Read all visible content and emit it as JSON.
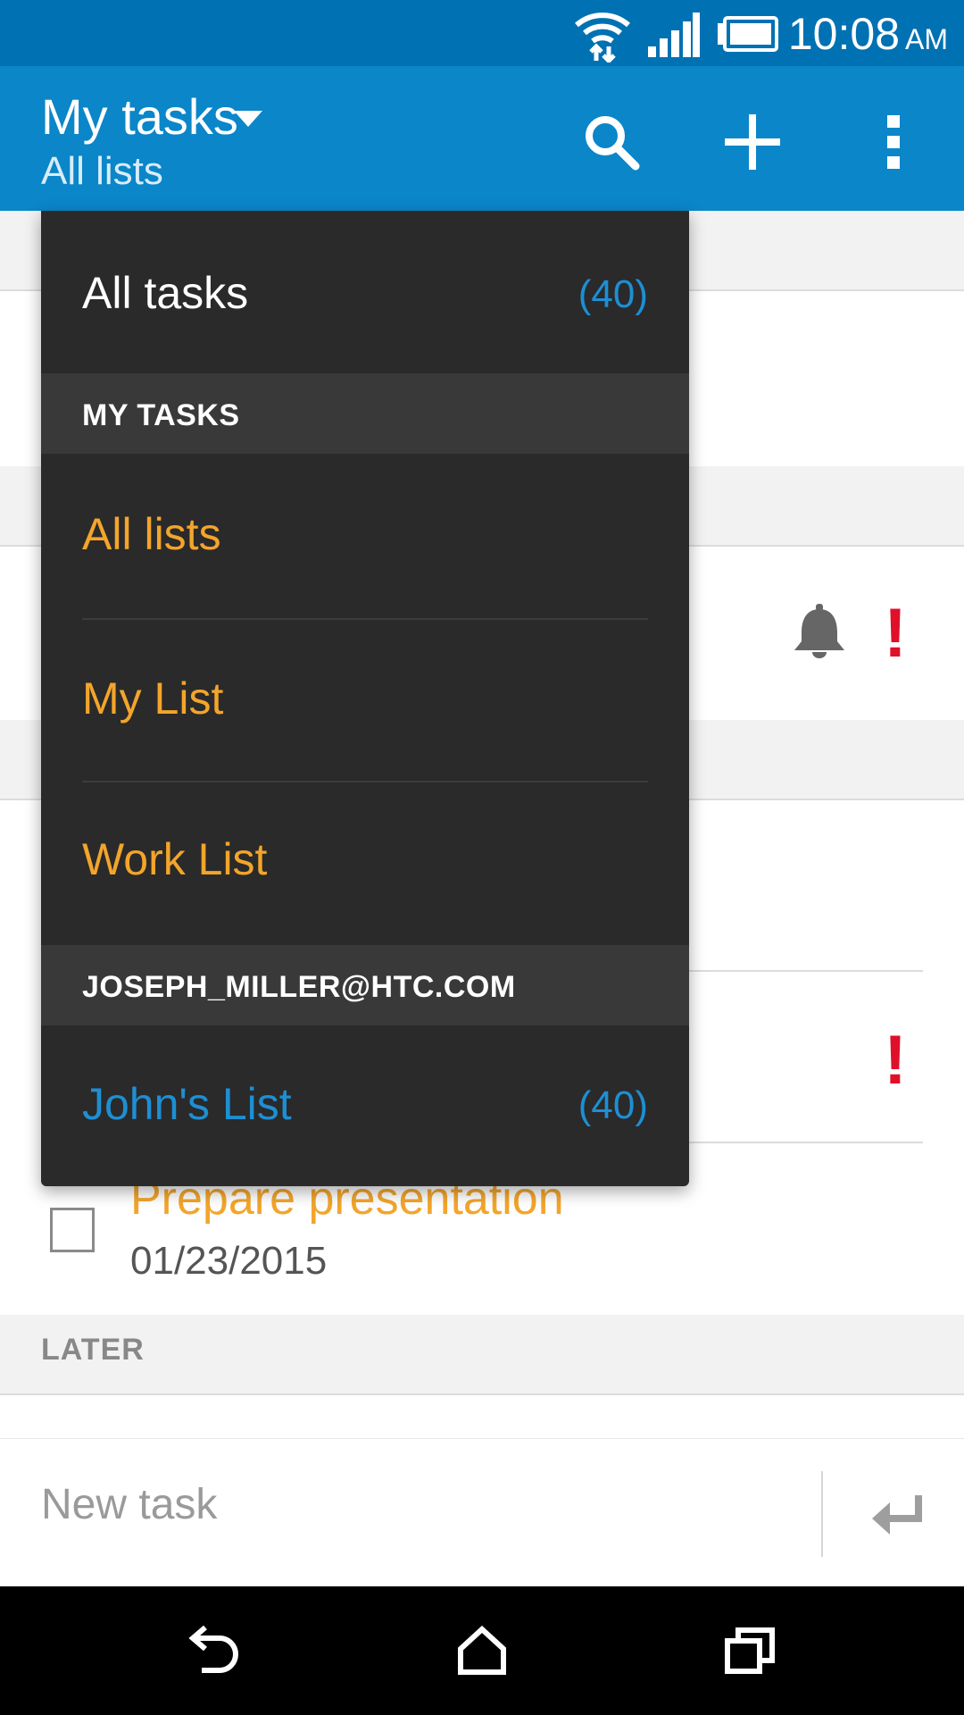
{
  "status_bar": {
    "time": "10:08",
    "ampm": "AM"
  },
  "app_bar": {
    "title": "My tasks",
    "subtitle": "All lists"
  },
  "dropdown": {
    "all_tasks": {
      "label": "All tasks",
      "count": "(40)"
    },
    "section_my_tasks": "MY TASKS",
    "lists": [
      {
        "label": "All lists"
      },
      {
        "label": "My List"
      },
      {
        "label": "Work List"
      }
    ],
    "section_account": "JOSEPH_MILLER@HTC.COM",
    "account_list": {
      "label": "John's List",
      "count": "(40)"
    }
  },
  "tasks": [
    {
      "title": "Prepare presentation",
      "date": "01/23/2015"
    }
  ],
  "sections": [
    {
      "label": "LATER"
    }
  ],
  "new_task": {
    "placeholder": "New task"
  },
  "colors": {
    "status_bar": "#0071b3",
    "app_bar": "#0a86c9",
    "dropdown_bg": "#2a2a2a",
    "dropdown_header": "#393939",
    "list_orange": "#f3a52b",
    "count_blue": "#1d8fd4",
    "priority_red": "#e0102a"
  }
}
